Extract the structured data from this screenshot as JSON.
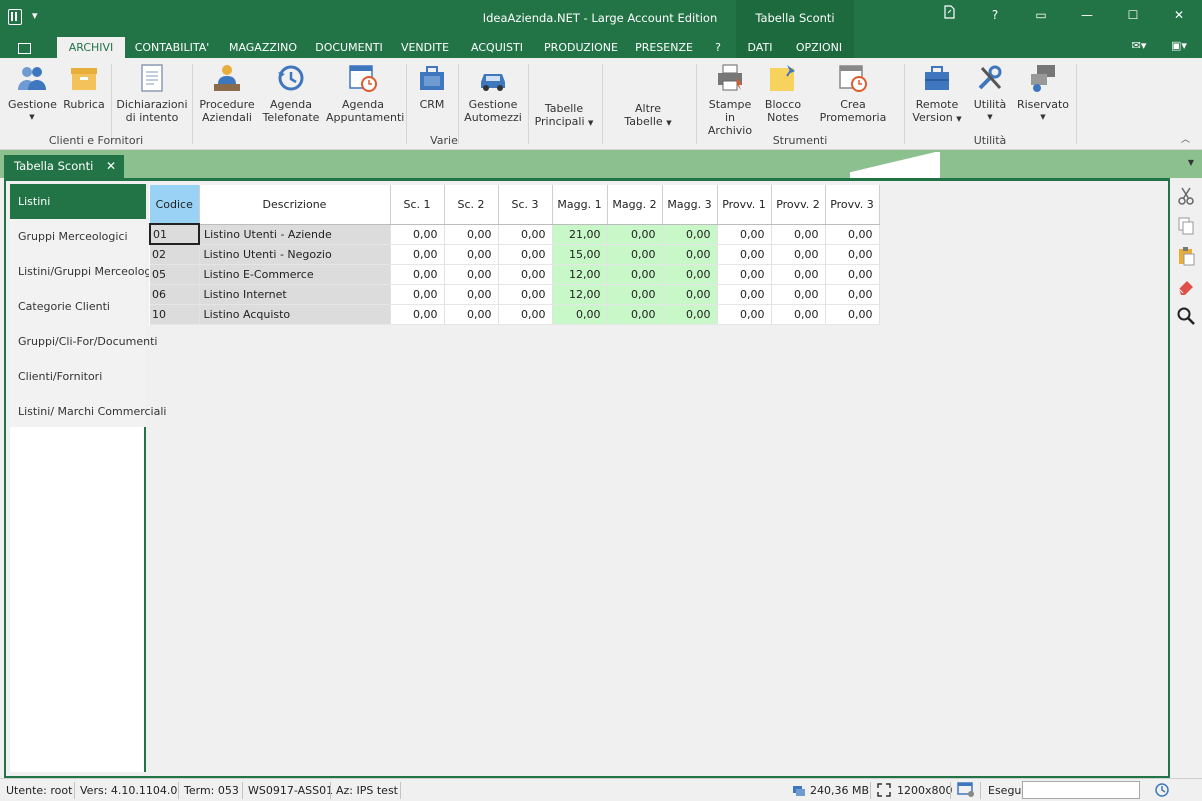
{
  "window": {
    "title": "IdeaAzienda.NET - Large Account Edition",
    "context_header": "Tabella Sconti",
    "controls": [
      "?",
      "▭",
      "—",
      "☐",
      "✕"
    ]
  },
  "ribbon_tabs": [
    "ARCHIVI",
    "CONTABILITA'",
    "MAGAZZINO",
    "DOCUMENTI",
    "VENDITE",
    "ACQUISTI",
    "PRODUZIONE",
    "PRESENZE",
    "?",
    "DATI",
    "OPZIONI"
  ],
  "ribbon": {
    "buttons": {
      "gestione": "Gestione",
      "rubrica": "Rubrica",
      "dichiarazioni_1": "Dichiarazioni",
      "dichiarazioni_2": "di intento",
      "procedure_1": "Procedure",
      "procedure_2": "Aziendali",
      "agenda_tel_1": "Agenda",
      "agenda_tel_2": "Telefonate",
      "agenda_app_1": "Agenda",
      "agenda_app_2": "Appuntamenti",
      "crm": "CRM",
      "automezzi_1": "Gestione",
      "automezzi_2": "Automezzi",
      "tabelle_1": "Tabelle",
      "tabelle_2": "Principali",
      "altre_1": "Altre",
      "altre_2": "Tabelle",
      "stampe_1": "Stampe in",
      "stampe_2": "Archivio",
      "blocco_1": "Blocco",
      "blocco_2": "Notes",
      "promemoria": "Crea Promemoria",
      "remote_1": "Remote",
      "remote_2": "Version",
      "utilita": "Utilità",
      "riservato": "Riservato"
    },
    "groups": {
      "clienti": "Clienti e Fornitori",
      "varie": "Varie",
      "strumenti": "Strumenti",
      "utilita": "Utilità"
    }
  },
  "doc_tab": {
    "label": "Tabella Sconti",
    "close": "✕"
  },
  "nav": [
    "Listini",
    "Gruppi Merceologici",
    "Listini/Gruppi Merceologici",
    "Categorie Clienti",
    "Gruppi/Cli-For/Documenti",
    "Clienti/Fornitori",
    "Listini/ Marchi Commerciali"
  ],
  "table": {
    "headers": [
      "Codice",
      "Descrizione",
      "Sc. 1",
      "Sc. 2",
      "Sc. 3",
      "Magg. 1",
      "Magg. 2",
      "Magg. 3",
      "Provv. 1",
      "Provv. 2",
      "Provv. 3"
    ],
    "rows": [
      [
        "01",
        "Listino Utenti - Aziende",
        "0,00",
        "0,00",
        "0,00",
        "21,00",
        "0,00",
        "0,00",
        "0,00",
        "0,00",
        "0,00"
      ],
      [
        "02",
        "Listino Utenti - Negozio",
        "0,00",
        "0,00",
        "0,00",
        "15,00",
        "0,00",
        "0,00",
        "0,00",
        "0,00",
        "0,00"
      ],
      [
        "05",
        "Listino E-Commerce",
        "0,00",
        "0,00",
        "0,00",
        "12,00",
        "0,00",
        "0,00",
        "0,00",
        "0,00",
        "0,00"
      ],
      [
        "06",
        "Listino Internet",
        "0,00",
        "0,00",
        "0,00",
        "12,00",
        "0,00",
        "0,00",
        "0,00",
        "0,00",
        "0,00"
      ],
      [
        "10",
        "Listino Acquisto",
        "0,00",
        "0,00",
        "0,00",
        "0,00",
        "0,00",
        "0,00",
        "0,00",
        "0,00",
        "0,00"
      ]
    ]
  },
  "status": {
    "utente": "Utente: root",
    "vers": "Vers: 4.10.1104.0",
    "term": "Term: 053",
    "ws": "WS0917-ASS01",
    "az": "Az: IPS test",
    "memory": "240,36 MB",
    "resolution": "1200x800",
    "esegui": "Esegui"
  },
  "colors": {
    "accent": "#227447",
    "header_selected": "#99d2f5",
    "magg_cells": "#c8f7c8",
    "doc_strip": "#8cc08e"
  }
}
